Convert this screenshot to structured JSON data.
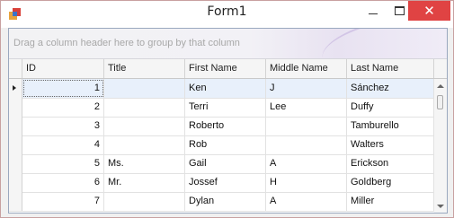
{
  "window": {
    "title": "Form1"
  },
  "grid": {
    "group_panel_text": "Drag a column header here to group by that column",
    "columns": [
      "ID",
      "Title",
      "First Name",
      "Middle Name",
      "Last Name"
    ],
    "rows": [
      {
        "id": "1",
        "title": "",
        "first": "Ken",
        "middle": "J",
        "last": "Sánchez"
      },
      {
        "id": "2",
        "title": "",
        "first": "Terri",
        "middle": "Lee",
        "last": "Duffy"
      },
      {
        "id": "3",
        "title": "",
        "first": "Roberto",
        "middle": "",
        "last": "Tamburello"
      },
      {
        "id": "4",
        "title": "",
        "first": "Rob",
        "middle": "",
        "last": "Walters"
      },
      {
        "id": "5",
        "title": "Ms.",
        "first": "Gail",
        "middle": "A",
        "last": "Erickson"
      },
      {
        "id": "6",
        "title": "Mr.",
        "first": "Jossef",
        "middle": "H",
        "last": "Goldberg"
      },
      {
        "id": "7",
        "title": "",
        "first": "Dylan",
        "middle": "A",
        "last": "Miller"
      }
    ],
    "selected_row": 0
  },
  "colors": {
    "close_button": "#e04343",
    "selected_row": "#e8f0fb"
  }
}
